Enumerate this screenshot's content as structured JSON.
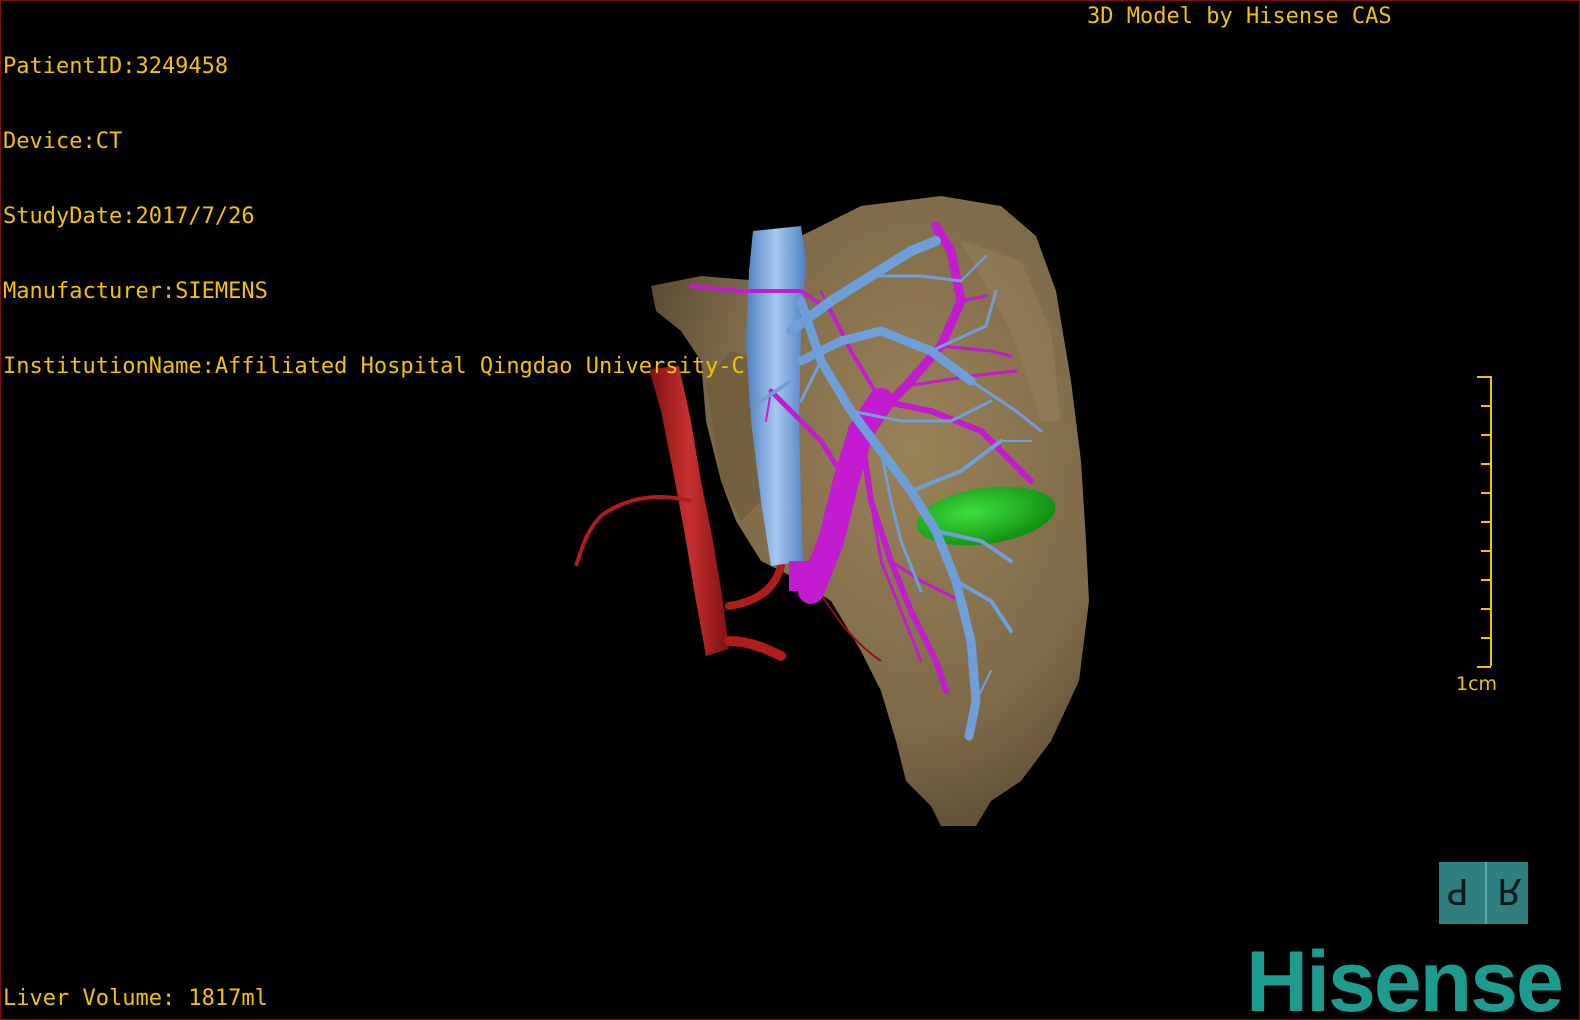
{
  "study_info": {
    "patient_id": "PatientID:3249458",
    "device": "Device:CT",
    "study_date": "StudyDate:2017/7/26",
    "manufacturer": "Manufacturer:SIEMENS",
    "institution": "InstitutionName:Affiliated Hospital Qingdao University-C"
  },
  "credit": "3D Model by Hisense CAS",
  "measurements": {
    "liver_volume": "Liver Volume: 1817ml"
  },
  "scale_bar": {
    "label": "1cm",
    "tick_count": 10
  },
  "orientation_cube": {
    "left_face": "P",
    "right_face": "R"
  },
  "brand": "Hisense",
  "colors": {
    "overlay_text": "#f2c200",
    "liver": "#84704d",
    "hepatic_vein": "#6f9fd8",
    "portal_vein": "#c21bd0",
    "artery": "#b01b1b",
    "gallbladder": "#1fb81f",
    "brand": "#1d9b8e",
    "cube": "#2f7e80"
  }
}
